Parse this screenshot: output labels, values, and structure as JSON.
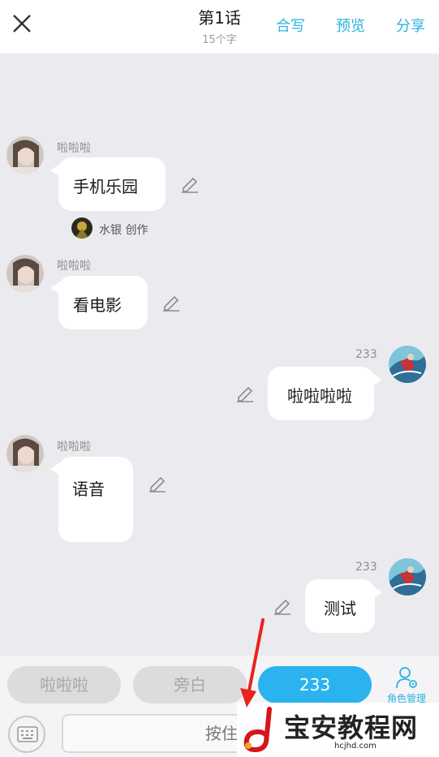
{
  "header": {
    "title": "第1话",
    "subtitle": "15个字",
    "actions": [
      "合写",
      "预览",
      "分享"
    ]
  },
  "messages": [
    {
      "side": "left",
      "name": "啦啦啦",
      "text": "手机乐园",
      "credit": "水银 创作"
    },
    {
      "side": "left",
      "name": "啦啦啦",
      "text": "看电影"
    },
    {
      "side": "right",
      "name": "233",
      "text": "啦啦啦啦"
    },
    {
      "side": "left",
      "name": "啦啦啦",
      "text": "语音"
    },
    {
      "side": "right",
      "name": "233",
      "text": "测试"
    }
  ],
  "roles": {
    "chips": [
      "啦啦啦",
      "旁白",
      "233"
    ],
    "active_index": 2,
    "manage_label": "角色管理"
  },
  "input": {
    "hold_label": "按住 配"
  },
  "watermark": {
    "text": "宝安教程网",
    "url": "hcjhd.com"
  },
  "colors": {
    "accent": "#2bb3e0",
    "active_chip": "#2bb3f0",
    "arrow": "#e8231c"
  }
}
